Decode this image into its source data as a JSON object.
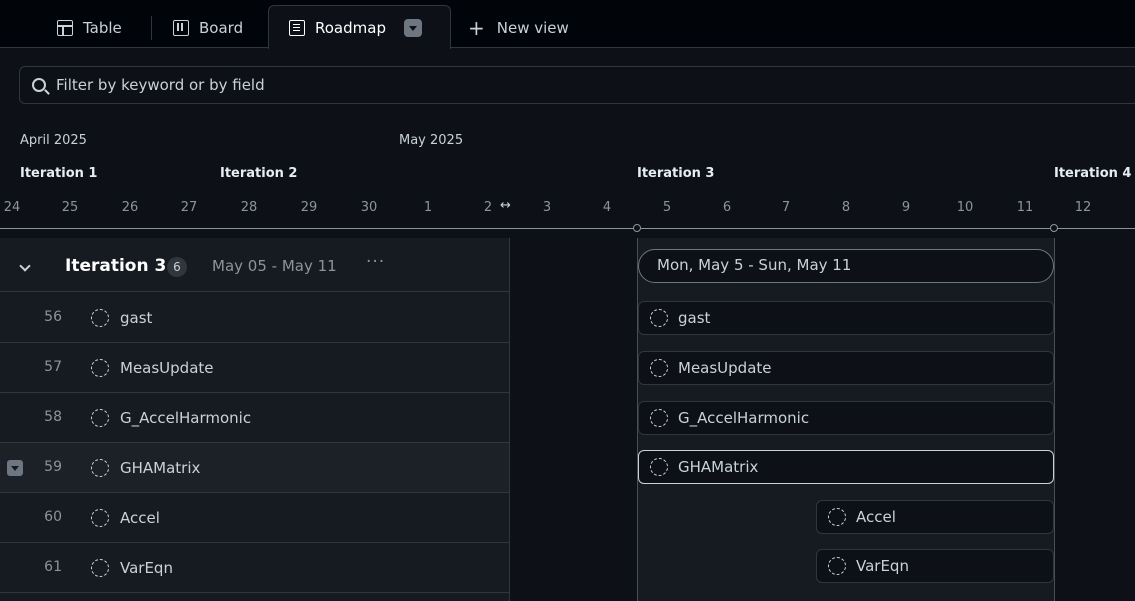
{
  "tabs": {
    "table": "Table",
    "board": "Board",
    "roadmap": "Roadmap",
    "new_view": "New view"
  },
  "filter": {
    "placeholder": "Filter by keyword or by field"
  },
  "timeline": {
    "months": [
      "April 2025",
      "May 2025"
    ],
    "iterations": [
      "Iteration 1",
      "Iteration 2",
      "Iteration 3",
      "Iteration 4"
    ],
    "days": [
      "24",
      "25",
      "26",
      "27",
      "28",
      "29",
      "30",
      "1",
      "2",
      "3",
      "4",
      "5",
      "6",
      "7",
      "8",
      "9",
      "10",
      "11",
      "12"
    ]
  },
  "group": {
    "title": "Iteration 3",
    "count": "6",
    "dates": "May 05 - May 11",
    "more": "···",
    "range_label": "Mon, May 5 - Sun, May 11"
  },
  "items": [
    {
      "num": "56",
      "title": "gast"
    },
    {
      "num": "57",
      "title": "MeasUpdate"
    },
    {
      "num": "58",
      "title": "G_AccelHarmonic"
    },
    {
      "num": "59",
      "title": "GHAMatrix"
    },
    {
      "num": "60",
      "title": "Accel"
    },
    {
      "num": "61",
      "title": "VarEqn"
    }
  ],
  "colors": {
    "bg": "#0d1117",
    "panel": "#161b22",
    "border": "#30363d",
    "text": "#c9d1d9"
  }
}
